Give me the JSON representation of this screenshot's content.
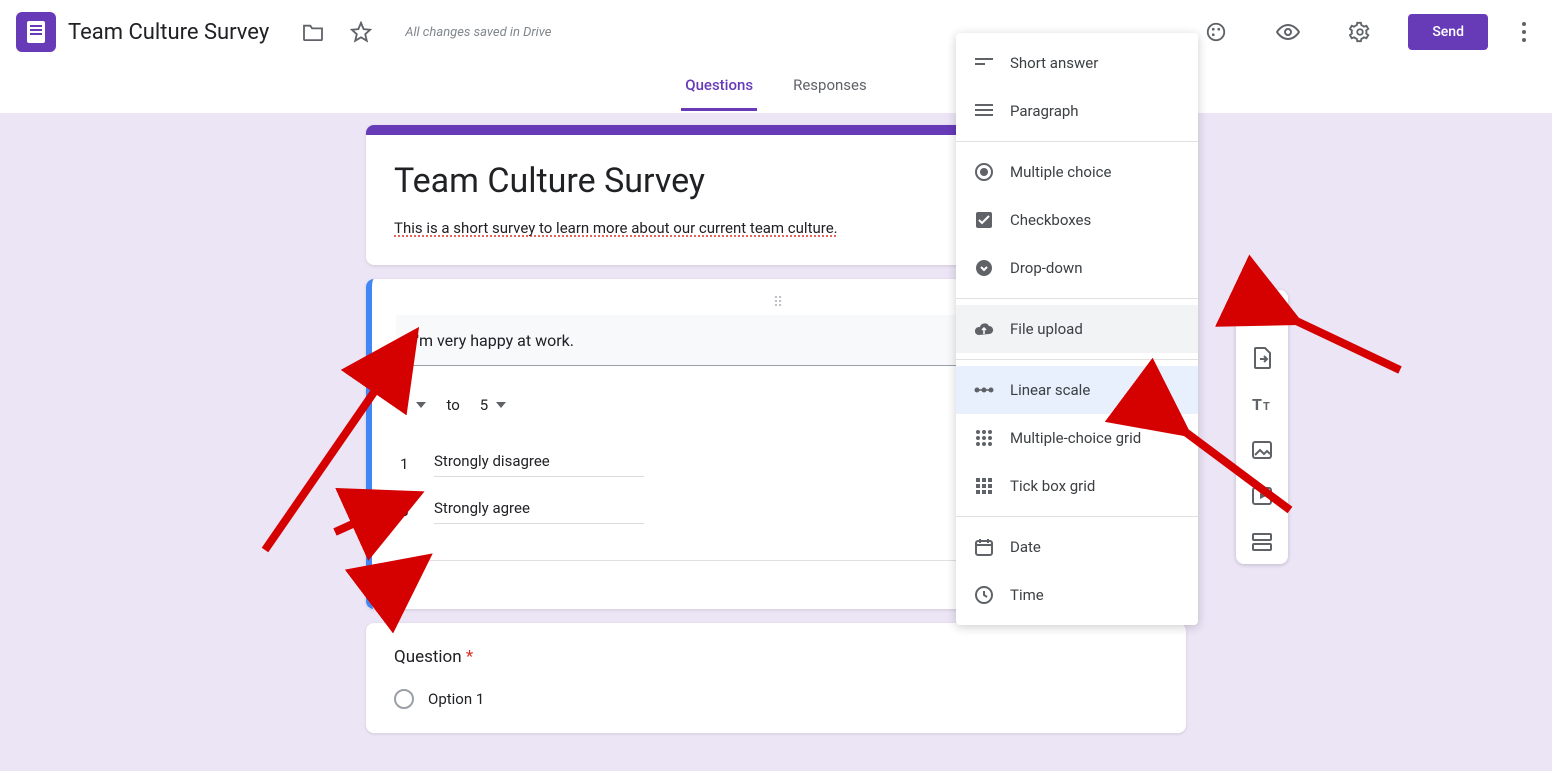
{
  "header": {
    "doc_title": "Team Culture Survey",
    "save_status": "All changes saved in Drive",
    "send_label": "Send"
  },
  "tabs": {
    "questions": "Questions",
    "responses": "Responses"
  },
  "form": {
    "title": "Team Culture Survey",
    "description": "This is a short survey to learn more about our current team culture."
  },
  "question1": {
    "text": "I'm very happy at work.",
    "scale_from": "1",
    "scale_word_to": "to",
    "scale_to": "5",
    "label_low_num": "1",
    "label_low_text": "Strongly disagree",
    "label_high_num": "5",
    "label_high_text": "Strongly agree"
  },
  "question2": {
    "title": "Question",
    "option1": "Option 1"
  },
  "type_menu": {
    "short_answer": "Short answer",
    "paragraph": "Paragraph",
    "multiple_choice": "Multiple choice",
    "checkboxes": "Checkboxes",
    "dropdown": "Drop-down",
    "file_upload": "File upload",
    "linear_scale": "Linear scale",
    "mc_grid": "Multiple-choice grid",
    "tick_grid": "Tick box grid",
    "date": "Date",
    "time": "Time"
  }
}
